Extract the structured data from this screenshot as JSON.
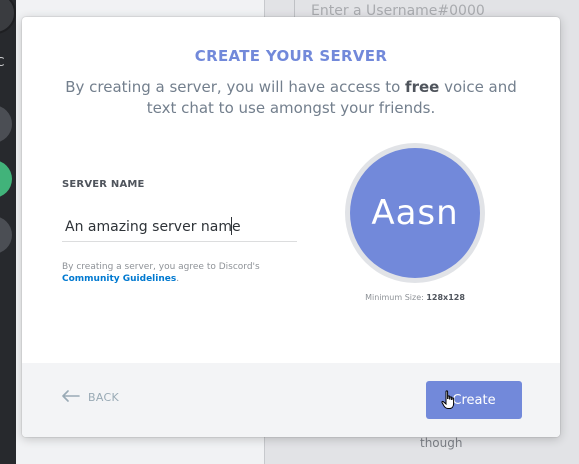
{
  "background": {
    "search_placeholder": "Enter a Username#0000",
    "guild_letter": "C",
    "footer_text": "though"
  },
  "modal": {
    "title": "CREATE YOUR SERVER",
    "description_before": "By creating a server, you will have access to ",
    "description_bold": "free",
    "description_after": " voice and text chat to use amongst your friends.",
    "server_name_label": "SERVER NAME",
    "server_name_value": "An amazing server name",
    "tos_text": "By creating a server, you agree to Discord's",
    "tos_link": "Community Guidelines",
    "tos_period": ".",
    "icon_initials": "Aasn",
    "min_size_label": "Minimum Size:",
    "min_size_value": "128x128",
    "back_label": "BACK",
    "create_label": "Create"
  },
  "colors": {
    "accent": "#7289da",
    "link": "#0079d0"
  }
}
